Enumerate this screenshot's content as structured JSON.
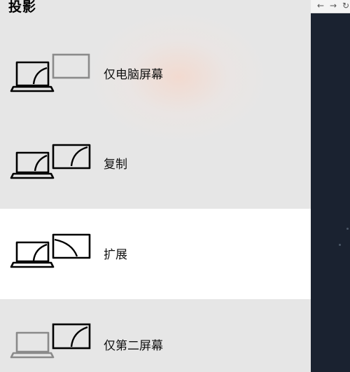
{
  "flyout": {
    "title": "投影",
    "options": [
      {
        "label": "仅电脑屏幕",
        "icon": "pc-screen-only-icon",
        "selected": false
      },
      {
        "label": "复制",
        "icon": "duplicate-icon",
        "selected": false
      },
      {
        "label": "扩展",
        "icon": "extend-icon",
        "selected": true
      },
      {
        "label": "仅第二屏幕",
        "icon": "second-screen-only-icon",
        "selected": false
      }
    ]
  },
  "browser": {
    "back_icon": "back-arrow-icon",
    "forward_icon": "forward-arrow-icon",
    "reload_icon": "reload-icon"
  },
  "colors": {
    "selected_background": "#ffffff",
    "flyout_background": "#e6e6e6",
    "active_stroke": "#000000",
    "inactive_stroke": "#8a8a8a",
    "side_window_background": "#1a2230"
  }
}
